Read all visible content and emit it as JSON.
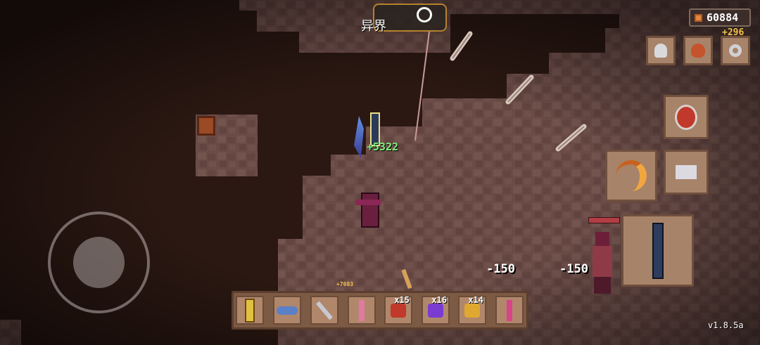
{
  "hud": {
    "coins": "60884",
    "coin_gain": "+296",
    "map_label": "异界",
    "version": "v1.8.5a"
  },
  "combat": {
    "damage_popup_1": "-150",
    "damage_popup_2": "-150",
    "heal_popup": "+5322",
    "small_drop_text": "+7083"
  },
  "top_buttons": [
    "skull-relic",
    "loot-bag",
    "settings-gear"
  ],
  "hotbar": {
    "items": [
      {
        "name": "golden-sword",
        "count": ""
      },
      {
        "name": "fish",
        "count": ""
      },
      {
        "name": "staff",
        "count": ""
      },
      {
        "name": "pink-rod",
        "count": ""
      },
      {
        "name": "red-potion",
        "count": "x15"
      },
      {
        "name": "purple-potion",
        "count": "x16"
      },
      {
        "name": "yellow-potion",
        "count": "x14"
      },
      {
        "name": "pink-wand",
        "count": ""
      }
    ]
  },
  "colors": {
    "rock": "#6a4c47",
    "dirt": "#2b1812",
    "slot": "#a78369",
    "accent": "#f6c14a"
  }
}
